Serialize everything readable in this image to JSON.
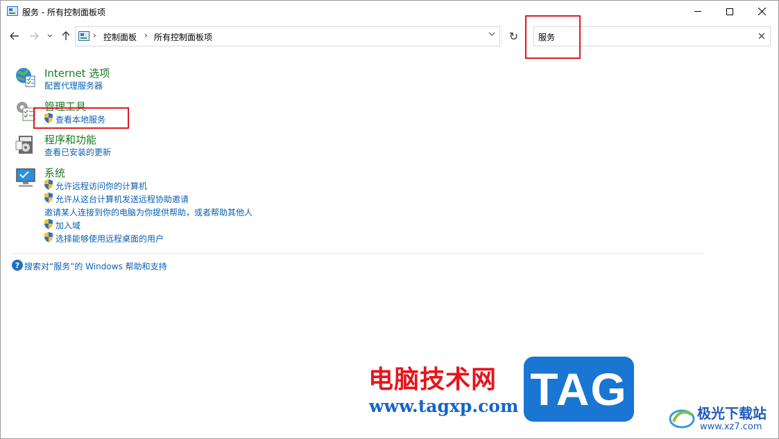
{
  "window": {
    "title": "服务 - 所有控制面板项"
  },
  "address": {
    "crumbs": [
      "控制面板",
      "所有控制面板项"
    ]
  },
  "search": {
    "value": "服务"
  },
  "groups": [
    {
      "title": "Internet 选项",
      "icon": "internet-options-icon",
      "tasks": [
        {
          "label": "配置代理服务器",
          "shield": false
        }
      ]
    },
    {
      "title": "管理工具",
      "icon": "admin-tools-icon",
      "tasks": [
        {
          "label": "查看本地服务",
          "shield": true
        }
      ]
    },
    {
      "title": "程序和功能",
      "icon": "programs-features-icon",
      "tasks": [
        {
          "label": "查看已安装的更新",
          "shield": false
        }
      ]
    },
    {
      "title": "系统",
      "icon": "system-icon",
      "tasks": [
        {
          "label": "允许远程访问你的计算机",
          "shield": true
        },
        {
          "label": "允许从这台计算机发送远程协助邀请",
          "shield": true
        },
        {
          "label": "邀请某人连接到你的电脑为你提供帮助，或者帮助其他人",
          "shield": false
        },
        {
          "label": "加入域",
          "shield": true
        },
        {
          "label": "选择能够使用远程桌面的用户",
          "shield": true
        }
      ]
    }
  ],
  "help": {
    "label": "搜索对“服务”的 Windows 帮助和支持"
  },
  "watermark": {
    "cn_text": "电脑技术网",
    "url": "www.tagxp.com",
    "tag": "TAG",
    "site_name": "极光下载站",
    "site_url": "www.xz7.com"
  },
  "colors": {
    "group_title": "#1a7a21",
    "link": "#0a5fb4",
    "highlight": "#e0191f"
  }
}
